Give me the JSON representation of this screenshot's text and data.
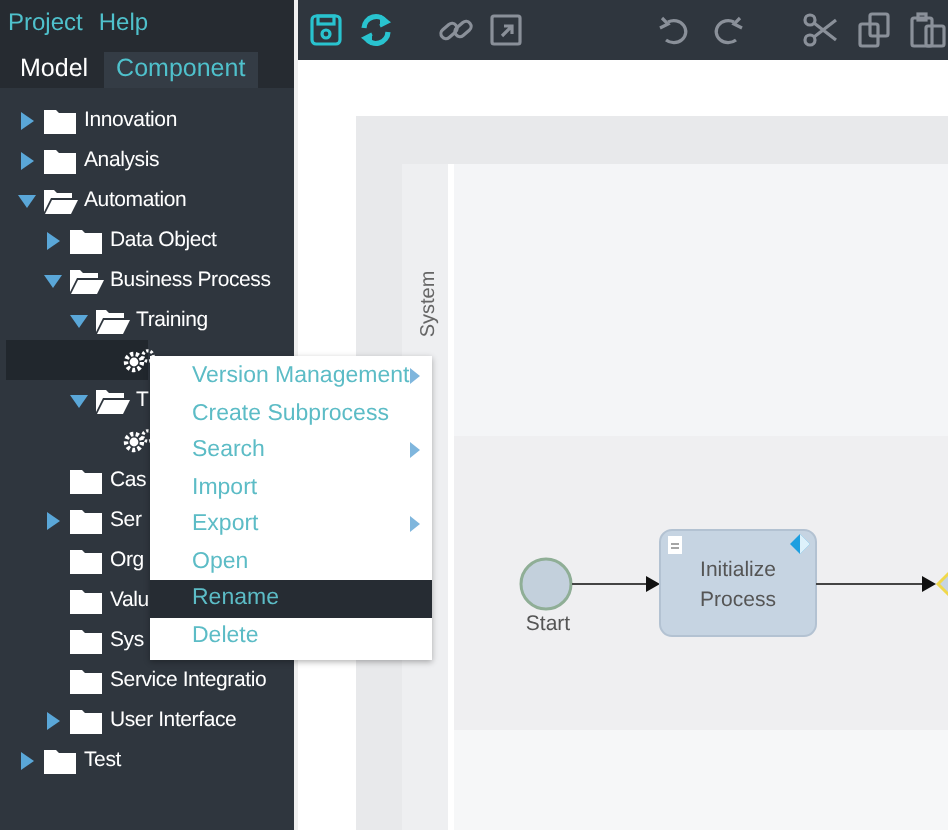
{
  "menu_bar": [
    "Project",
    "Help"
  ],
  "panel_tabs": [
    {
      "label": "Model",
      "selected": true
    },
    {
      "label": "Component",
      "selected": false
    }
  ],
  "tree": [
    {
      "kind": "folder",
      "label": "Innovation",
      "expanded": false,
      "selected": false
    },
    {
      "kind": "folder",
      "label": "Analysis",
      "expanded": false,
      "selected": false
    },
    {
      "kind": "folder",
      "label": "Automation",
      "expanded": true,
      "selected": false,
      "children": [
        {
          "kind": "folder",
          "label": "Data Object",
          "expanded": false,
          "selected": false
        },
        {
          "kind": "folder",
          "label": "Business Process",
          "expanded": true,
          "selected": false,
          "children": [
            {
              "kind": "folder",
              "label": "Training",
              "expanded": true,
              "selected": false,
              "children": [
                {
                  "kind": "process",
                  "selected": true
                }
              ]
            },
            {
              "kind": "folder",
              "label": "T",
              "expanded": true,
              "selected": false,
              "children": [
                {
                  "kind": "process",
                  "selected": false
                }
              ]
            }
          ]
        },
        {
          "kind": "leaf",
          "label": "Cas",
          "selected": false
        },
        {
          "kind": "folder",
          "label": "Ser",
          "expanded": false,
          "selected": false
        },
        {
          "kind": "leaf",
          "label": "Org",
          "selected": false
        },
        {
          "kind": "leaf",
          "label": "Valu",
          "selected": false
        },
        {
          "kind": "leaf",
          "label": "Sys",
          "selected": false
        },
        {
          "kind": "leaf",
          "label": "Service Integratio",
          "selected": false
        },
        {
          "kind": "folder",
          "label": "User Interface",
          "expanded": false,
          "selected": false
        }
      ]
    },
    {
      "kind": "folder",
      "label": "Test",
      "expanded": false,
      "selected": false
    }
  ],
  "context_menu": [
    {
      "label": "Version Management",
      "submenu": true,
      "selected": false
    },
    {
      "label": "Create Subprocess",
      "submenu": false,
      "selected": false
    },
    {
      "label": "Search",
      "submenu": true,
      "selected": false
    },
    {
      "label": "Import",
      "submenu": false,
      "selected": false
    },
    {
      "label": "Export",
      "submenu": true,
      "selected": false
    },
    {
      "label": "Open",
      "submenu": false,
      "selected": false
    },
    {
      "label": "Rename",
      "submenu": false,
      "selected": true
    },
    {
      "label": "Delete",
      "submenu": false,
      "selected": false
    }
  ],
  "toolbar": [
    [
      {
        "kind": "save",
        "disabled": false
      },
      {
        "kind": "refresh",
        "disabled": false
      }
    ],
    [
      {
        "kind": "link",
        "disabled": true
      },
      {
        "kind": "external",
        "disabled": true
      }
    ],
    [
      {
        "kind": "undo",
        "disabled": true
      },
      {
        "kind": "redo",
        "disabled": true
      }
    ],
    [
      {
        "kind": "cut",
        "disabled": true
      },
      {
        "kind": "copy",
        "disabled": true
      },
      {
        "kind": "paste",
        "disabled": true
      }
    ]
  ],
  "diagram": {
    "lane": "System",
    "nodes": [
      {
        "kind": "start",
        "label": "Start"
      },
      {
        "kind": "task",
        "label": "Initialize Process"
      },
      {
        "kind": "gateway"
      }
    ]
  }
}
